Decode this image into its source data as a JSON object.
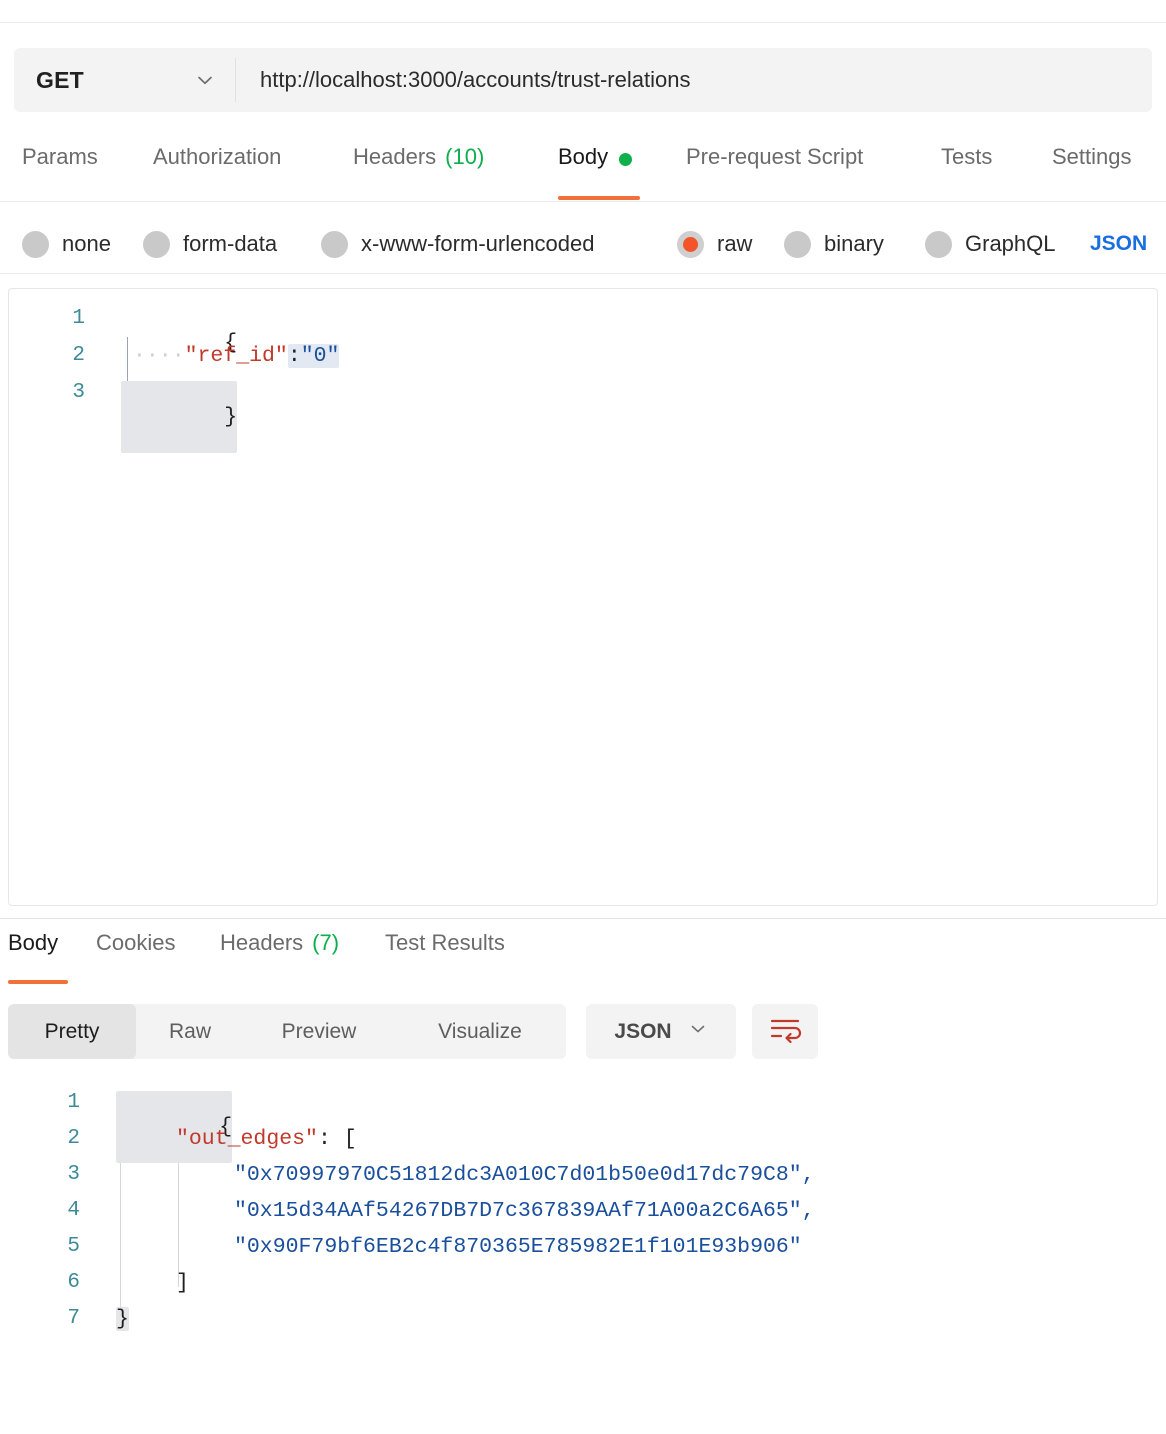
{
  "request": {
    "method": "GET",
    "url": "http://localhost:3000/accounts/trust-relations",
    "method_chevron_icon": "chevron-down-icon",
    "tabs": [
      {
        "label": "Params",
        "count": "",
        "active": false
      },
      {
        "label": "Authorization",
        "count": "",
        "active": false
      },
      {
        "label": "Headers",
        "count": "(10)",
        "active": false
      },
      {
        "label": "Body",
        "count": "",
        "active": true,
        "dot": true
      },
      {
        "label": "Pre-request Script",
        "count": "",
        "active": false
      },
      {
        "label": "Tests",
        "count": "",
        "active": false
      },
      {
        "label": "Settings",
        "count": "",
        "active": false
      }
    ],
    "body_types": [
      {
        "label": "none",
        "selected": false
      },
      {
        "label": "form-data",
        "selected": false
      },
      {
        "label": "x-www-form-urlencoded",
        "selected": false
      },
      {
        "label": "raw",
        "selected": true
      },
      {
        "label": "binary",
        "selected": false
      },
      {
        "label": "GraphQL",
        "selected": false
      }
    ],
    "raw_format": "JSON",
    "body_lines": [
      {
        "num": "1",
        "text": "{"
      },
      {
        "num": "2",
        "text": "    \"ref_id\":\"0\""
      },
      {
        "num": "3",
        "text": "}"
      }
    ],
    "body_key": "\"ref_id\"",
    "body_colon": ":",
    "body_value": "\"0\"",
    "body_indent_dots": "····",
    "body_open_brace": "{",
    "body_close_brace": "}"
  },
  "response": {
    "tabs": [
      {
        "label": "Body",
        "count": "",
        "active": true
      },
      {
        "label": "Cookies",
        "count": "",
        "active": false
      },
      {
        "label": "Headers",
        "count": "(7)",
        "active": false
      },
      {
        "label": "Test Results",
        "count": "",
        "active": false
      }
    ],
    "view_modes": [
      {
        "label": "Pretty",
        "active": true
      },
      {
        "label": "Raw",
        "active": false
      },
      {
        "label": "Preview",
        "active": false
      },
      {
        "label": "Visualize",
        "active": false
      }
    ],
    "format": "JSON",
    "format_chevron_icon": "chevron-down-icon",
    "wrap_icon": "wrap-text-icon",
    "line_numbers": [
      "1",
      "2",
      "3",
      "4",
      "5",
      "6",
      "7"
    ],
    "open_brace": "{",
    "key": "\"out_edges\"",
    "key_suffix": ": [",
    "values": [
      "\"0x70997970C51812dc3A010C7d01b50e0d17dc79C8\",",
      "\"0x15d34AAf54267DB7D7c367839AAf71A00a2C6A65\",",
      "\"0x90F79bf6EB2c4f870365E785982E1f101E93b906\""
    ],
    "close_bracket": "]",
    "close_brace": "}"
  },
  "colors": {
    "accent": "#f2703a",
    "selected_radio": "#f4542a",
    "count_green": "#0cae4e",
    "json_link_blue": "#1a6fe0",
    "json_key_red": "#c0392b",
    "json_string_blue": "#1a4f9c",
    "line_number": "#3d8b96"
  }
}
